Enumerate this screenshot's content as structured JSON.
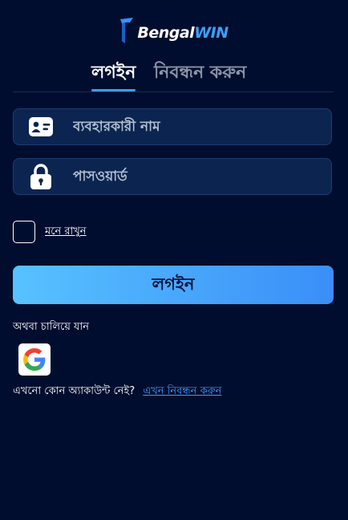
{
  "brand": {
    "prefix": "Bengal",
    "suffix": "WIN"
  },
  "tabs": [
    {
      "label": "লগইন",
      "active": true
    },
    {
      "label": "নিবন্ধন করুন",
      "active": false
    }
  ],
  "form": {
    "username": {
      "placeholder": "ব্যবহারকারী নাম",
      "value": "",
      "icon": "id-card-icon"
    },
    "password": {
      "placeholder": "পাসওয়ার্ড",
      "value": "",
      "icon": "lock-icon"
    },
    "remember_label": "মনে রাখুন",
    "remember_checked": false,
    "submit_label": "লগইন"
  },
  "alternate": {
    "label": "অথবা চালিয়ে যান",
    "providers": [
      {
        "name": "google",
        "icon": "google-icon"
      }
    ]
  },
  "signup": {
    "prompt": "এখনো কোন অ্যাকাউন্ট নেই?",
    "link_label": "এখন নিবন্ধন করুন"
  },
  "colors": {
    "background": "#010d2e",
    "accent": "#3d9bff",
    "field_bg": "#0b2550",
    "button_gradient_start": "#58c2ff",
    "button_gradient_end": "#3a8ef8"
  }
}
